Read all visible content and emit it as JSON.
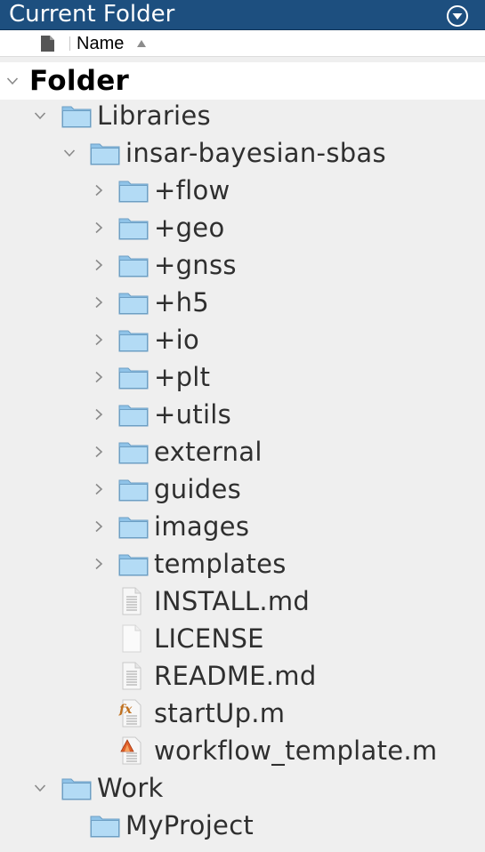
{
  "window": {
    "title": "Current Folder"
  },
  "columns": {
    "name_header": "Name"
  },
  "colors": {
    "titlebar": "#1d4f7f",
    "folder": "#a9d3f0"
  },
  "tree": {
    "group": {
      "label": "Folder",
      "expanded": true
    },
    "libraries": {
      "label": "Libraries",
      "expanded": true
    },
    "package": {
      "label": "insar-bayesian-sbas",
      "expanded": true
    },
    "subfolders": [
      {
        "label": "+flow",
        "expanded": false
      },
      {
        "label": "+geo",
        "expanded": false
      },
      {
        "label": "+gnss",
        "expanded": false
      },
      {
        "label": "+h5",
        "expanded": false
      },
      {
        "label": "+io",
        "expanded": false
      },
      {
        "label": "+plt",
        "expanded": false
      },
      {
        "label": "+utils",
        "expanded": false
      },
      {
        "label": "external",
        "expanded": false
      },
      {
        "label": "guides",
        "expanded": false
      },
      {
        "label": "images",
        "expanded": false
      },
      {
        "label": "templates",
        "expanded": false
      }
    ],
    "files": [
      {
        "label": "INSTALL.md",
        "icon": "text-file-icon"
      },
      {
        "label": "LICENSE",
        "icon": "blank-file-icon"
      },
      {
        "label": "README.md",
        "icon": "text-file-icon"
      },
      {
        "label": "startUp.m",
        "icon": "matlab-function-icon"
      },
      {
        "label": "workflow_template.m",
        "icon": "matlab-script-icon"
      }
    ],
    "work": {
      "label": "Work",
      "expanded": true
    },
    "project": {
      "label": "MyProject"
    }
  }
}
